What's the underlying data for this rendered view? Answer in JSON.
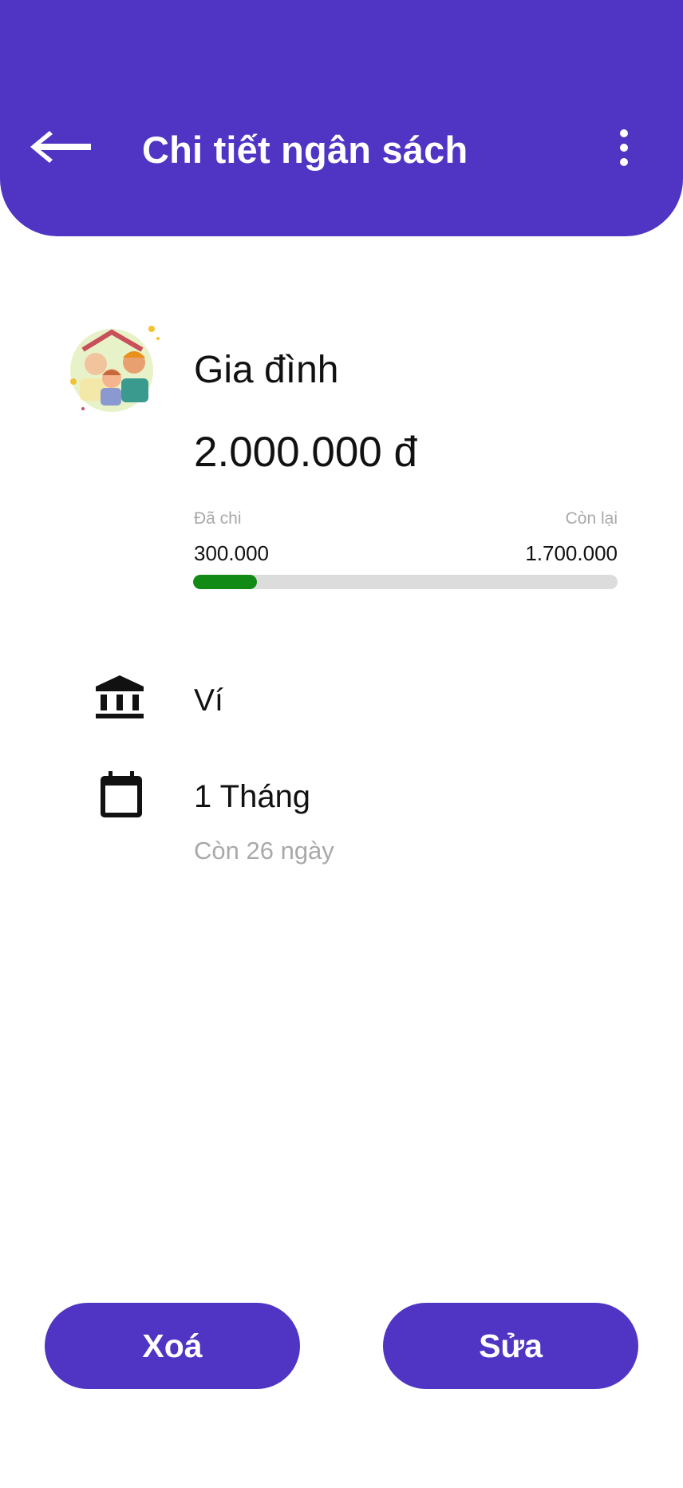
{
  "header": {
    "title": "Chi tiết ngân sách",
    "background_color": "#5035C4",
    "back_icon": "arrow-left-icon",
    "menu_icon": "more-vertical-icon"
  },
  "budget": {
    "avatar_icon": "family-icon",
    "category": "Gia đình",
    "amount": "2.000.000 đ",
    "spent_label": "Đã chi",
    "spent_value": "300.000",
    "remaining_label": "Còn lại",
    "remaining_value": "1.700.000",
    "progress_fraction": 0.15,
    "progress_color": "#128a16"
  },
  "wallet": {
    "icon": "bank-icon",
    "label": "Ví"
  },
  "period": {
    "icon": "calendar-icon",
    "label": "1 Tháng",
    "days_left": "Còn 26 ngày"
  },
  "actions": {
    "delete_label": "Xoá",
    "edit_label": "Sửa"
  }
}
